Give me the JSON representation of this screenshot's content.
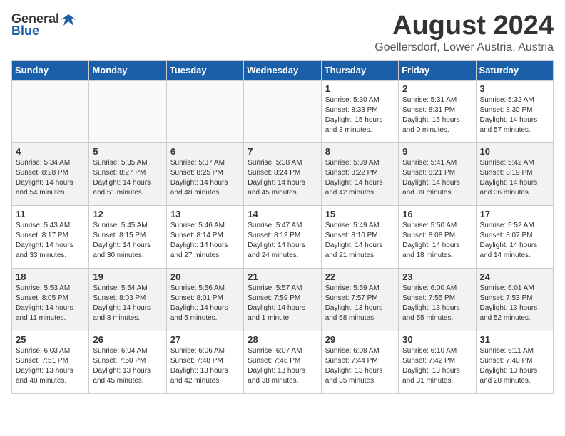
{
  "header": {
    "logo_general": "General",
    "logo_blue": "Blue",
    "month_title": "August 2024",
    "location": "Goellersdorf, Lower Austria, Austria"
  },
  "weekdays": [
    "Sunday",
    "Monday",
    "Tuesday",
    "Wednesday",
    "Thursday",
    "Friday",
    "Saturday"
  ],
  "weeks": [
    [
      {
        "day": "",
        "info": ""
      },
      {
        "day": "",
        "info": ""
      },
      {
        "day": "",
        "info": ""
      },
      {
        "day": "",
        "info": ""
      },
      {
        "day": "1",
        "info": "Sunrise: 5:30 AM\nSunset: 8:33 PM\nDaylight: 15 hours\nand 3 minutes."
      },
      {
        "day": "2",
        "info": "Sunrise: 5:31 AM\nSunset: 8:31 PM\nDaylight: 15 hours\nand 0 minutes."
      },
      {
        "day": "3",
        "info": "Sunrise: 5:32 AM\nSunset: 8:30 PM\nDaylight: 14 hours\nand 57 minutes."
      }
    ],
    [
      {
        "day": "4",
        "info": "Sunrise: 5:34 AM\nSunset: 8:28 PM\nDaylight: 14 hours\nand 54 minutes."
      },
      {
        "day": "5",
        "info": "Sunrise: 5:35 AM\nSunset: 8:27 PM\nDaylight: 14 hours\nand 51 minutes."
      },
      {
        "day": "6",
        "info": "Sunrise: 5:37 AM\nSunset: 8:25 PM\nDaylight: 14 hours\nand 48 minutes."
      },
      {
        "day": "7",
        "info": "Sunrise: 5:38 AM\nSunset: 8:24 PM\nDaylight: 14 hours\nand 45 minutes."
      },
      {
        "day": "8",
        "info": "Sunrise: 5:39 AM\nSunset: 8:22 PM\nDaylight: 14 hours\nand 42 minutes."
      },
      {
        "day": "9",
        "info": "Sunrise: 5:41 AM\nSunset: 8:21 PM\nDaylight: 14 hours\nand 39 minutes."
      },
      {
        "day": "10",
        "info": "Sunrise: 5:42 AM\nSunset: 8:19 PM\nDaylight: 14 hours\nand 36 minutes."
      }
    ],
    [
      {
        "day": "11",
        "info": "Sunrise: 5:43 AM\nSunset: 8:17 PM\nDaylight: 14 hours\nand 33 minutes."
      },
      {
        "day": "12",
        "info": "Sunrise: 5:45 AM\nSunset: 8:15 PM\nDaylight: 14 hours\nand 30 minutes."
      },
      {
        "day": "13",
        "info": "Sunrise: 5:46 AM\nSunset: 8:14 PM\nDaylight: 14 hours\nand 27 minutes."
      },
      {
        "day": "14",
        "info": "Sunrise: 5:47 AM\nSunset: 8:12 PM\nDaylight: 14 hours\nand 24 minutes."
      },
      {
        "day": "15",
        "info": "Sunrise: 5:49 AM\nSunset: 8:10 PM\nDaylight: 14 hours\nand 21 minutes."
      },
      {
        "day": "16",
        "info": "Sunrise: 5:50 AM\nSunset: 8:08 PM\nDaylight: 14 hours\nand 18 minutes."
      },
      {
        "day": "17",
        "info": "Sunrise: 5:52 AM\nSunset: 8:07 PM\nDaylight: 14 hours\nand 14 minutes."
      }
    ],
    [
      {
        "day": "18",
        "info": "Sunrise: 5:53 AM\nSunset: 8:05 PM\nDaylight: 14 hours\nand 11 minutes."
      },
      {
        "day": "19",
        "info": "Sunrise: 5:54 AM\nSunset: 8:03 PM\nDaylight: 14 hours\nand 8 minutes."
      },
      {
        "day": "20",
        "info": "Sunrise: 5:56 AM\nSunset: 8:01 PM\nDaylight: 14 hours\nand 5 minutes."
      },
      {
        "day": "21",
        "info": "Sunrise: 5:57 AM\nSunset: 7:59 PM\nDaylight: 14 hours\nand 1 minute."
      },
      {
        "day": "22",
        "info": "Sunrise: 5:59 AM\nSunset: 7:57 PM\nDaylight: 13 hours\nand 58 minutes."
      },
      {
        "day": "23",
        "info": "Sunrise: 6:00 AM\nSunset: 7:55 PM\nDaylight: 13 hours\nand 55 minutes."
      },
      {
        "day": "24",
        "info": "Sunrise: 6:01 AM\nSunset: 7:53 PM\nDaylight: 13 hours\nand 52 minutes."
      }
    ],
    [
      {
        "day": "25",
        "info": "Sunrise: 6:03 AM\nSunset: 7:51 PM\nDaylight: 13 hours\nand 48 minutes."
      },
      {
        "day": "26",
        "info": "Sunrise: 6:04 AM\nSunset: 7:50 PM\nDaylight: 13 hours\nand 45 minutes."
      },
      {
        "day": "27",
        "info": "Sunrise: 6:06 AM\nSunset: 7:48 PM\nDaylight: 13 hours\nand 42 minutes."
      },
      {
        "day": "28",
        "info": "Sunrise: 6:07 AM\nSunset: 7:46 PM\nDaylight: 13 hours\nand 38 minutes."
      },
      {
        "day": "29",
        "info": "Sunrise: 6:08 AM\nSunset: 7:44 PM\nDaylight: 13 hours\nand 35 minutes."
      },
      {
        "day": "30",
        "info": "Sunrise: 6:10 AM\nSunset: 7:42 PM\nDaylight: 13 hours\nand 31 minutes."
      },
      {
        "day": "31",
        "info": "Sunrise: 6:11 AM\nSunset: 7:40 PM\nDaylight: 13 hours\nand 28 minutes."
      }
    ]
  ],
  "colors": {
    "header_bg": "#1a5fa8",
    "shaded_row": "#f2f2f2"
  }
}
